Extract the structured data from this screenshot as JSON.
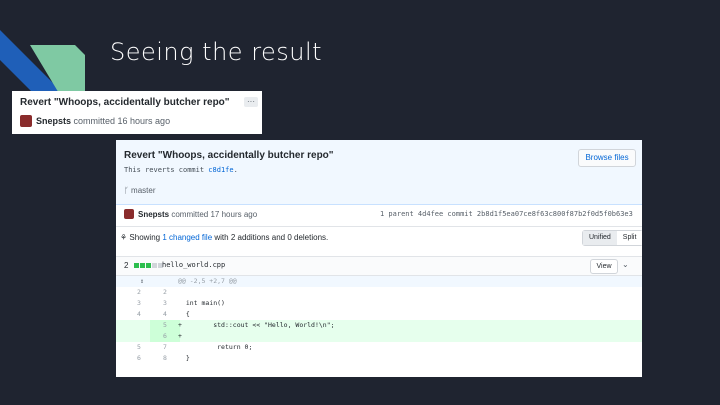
{
  "slide": {
    "title": "Seeing the result"
  },
  "colors": {
    "deco_blue": "#1f5fb8",
    "deco_green": "#7fc9a3",
    "background": "#1f2430",
    "add_bg": "#e6ffed"
  },
  "small": {
    "title": "Revert \"Whoops, accidentally butcher repo\"",
    "ellipsis": "···",
    "author": "Snepsts",
    "action": " committed 16 hours ago"
  },
  "big": {
    "title": "Revert \"Whoops, accidentally butcher repo\"",
    "desc_prefix": "This reverts commit ",
    "desc_sha": "c8d1fe",
    "desc_suffix": ".",
    "browse": "Browse files",
    "branch": "master",
    "author": "Snepsts",
    "action": " committed 17 hours ago",
    "meta_right": "1 parent 4d4fee  commit 2b8d1f5ea07ce8f63c800f87b2f0d5f0b63e3",
    "showing_prefix": "Showing ",
    "showing_link": "1 changed file",
    "showing_suffix": " with 2 additions and 0 deletions.",
    "unified": "Unified",
    "split": "Split",
    "file_count": "2",
    "file_name": "hello_world.cpp",
    "view": "View",
    "chevron": "⌄"
  },
  "diff": [
    {
      "type": "hunk",
      "n1": "",
      "n2": "",
      "code": "@@ -2,5 +2,7 @@"
    },
    {
      "type": "ctx",
      "n1": "2",
      "n2": "2",
      "code": ""
    },
    {
      "type": "ctx",
      "n1": "3",
      "n2": "3",
      "code": "  int main()"
    },
    {
      "type": "ctx",
      "n1": "4",
      "n2": "4",
      "code": "  {"
    },
    {
      "type": "add",
      "n1": "",
      "n2": "5",
      "code": "+        std::cout << \"Hello, World!\\n\";"
    },
    {
      "type": "add",
      "n1": "",
      "n2": "6",
      "code": "+"
    },
    {
      "type": "ctx",
      "n1": "5",
      "n2": "7",
      "code": "          return 0;"
    },
    {
      "type": "ctx",
      "n1": "6",
      "n2": "8",
      "code": "  }"
    }
  ]
}
